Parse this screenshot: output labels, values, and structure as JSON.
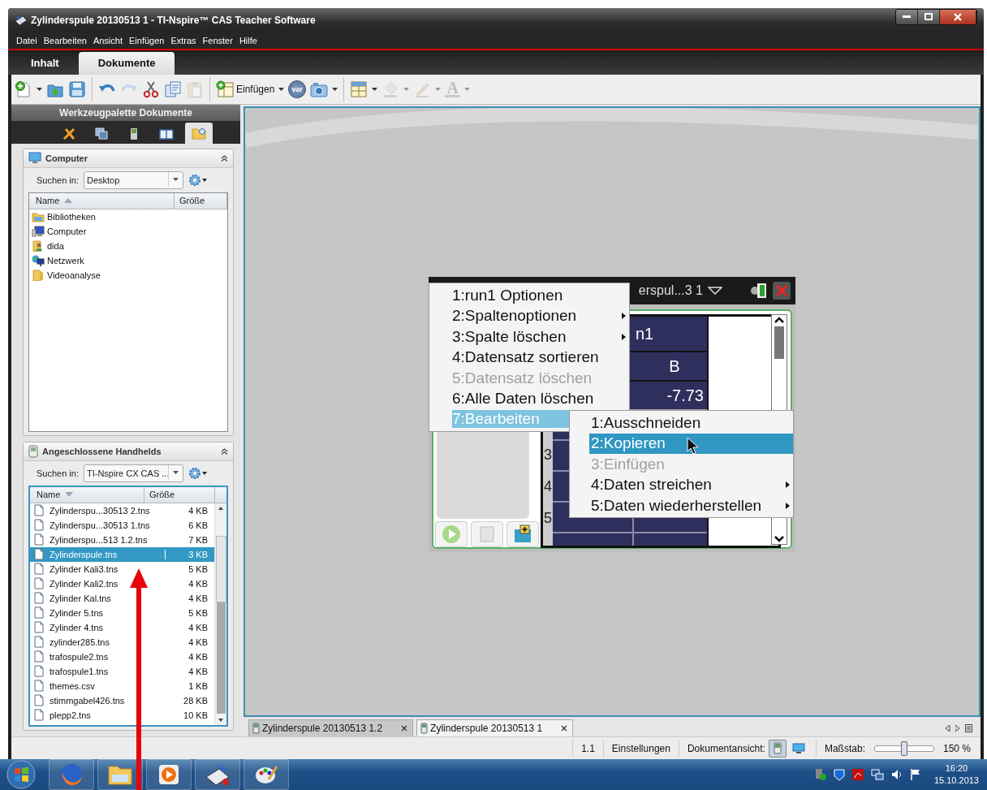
{
  "window": {
    "title": "Zylinderspule 20130513 1 - TI-Nspire™ CAS Teacher Software"
  },
  "menu": [
    "Datei",
    "Bearbeiten",
    "Ansicht",
    "Einfügen",
    "Extras",
    "Fenster",
    "Hilfe"
  ],
  "workspace_tabs": [
    {
      "label": "Inhalt",
      "selected": false
    },
    {
      "label": "Dokumente",
      "selected": true
    }
  ],
  "toolbar": [
    {
      "kind": "new",
      "caret": true,
      "disabled": false
    },
    {
      "kind": "open",
      "caret": false,
      "disabled": false
    },
    {
      "kind": "save",
      "caret": false,
      "disabled": false
    },
    {
      "kind": "separator"
    },
    {
      "kind": "undo",
      "caret": false,
      "disabled": false
    },
    {
      "kind": "redo",
      "caret": false,
      "disabled": true
    },
    {
      "kind": "cut",
      "caret": false,
      "disabled": false
    },
    {
      "kind": "copy",
      "caret": false,
      "disabled": false
    },
    {
      "kind": "paste",
      "caret": false,
      "disabled": true
    },
    {
      "kind": "separator"
    },
    {
      "kind": "insert",
      "label": "Einfügen",
      "caret": true,
      "disabled": false
    },
    {
      "kind": "variable",
      "label": "var",
      "caret": false,
      "disabled": false
    },
    {
      "kind": "camera",
      "caret": true,
      "disabled": false
    },
    {
      "kind": "separator"
    },
    {
      "kind": "layout",
      "caret": true,
      "disabled": false
    },
    {
      "kind": "fill",
      "caret": true,
      "disabled": true
    },
    {
      "kind": "pen",
      "caret": true,
      "disabled": true
    },
    {
      "kind": "text",
      "label": "A",
      "caret": true,
      "disabled": true
    }
  ],
  "palette": {
    "title": "Werkzeugpalette Dokumente",
    "tabs": [
      {
        "kind": "tools",
        "selected": false
      },
      {
        "kind": "pages",
        "selected": false
      },
      {
        "kind": "handheld",
        "selected": false
      },
      {
        "kind": "book",
        "selected": false
      },
      {
        "kind": "folder",
        "selected": true
      }
    ]
  },
  "computer_panel": {
    "title": "Computer",
    "search_label": "Suchen in:",
    "location": "Desktop",
    "columns": [
      {
        "label": "Name",
        "sort_descending": false
      },
      {
        "label": "Größe"
      }
    ],
    "rows": [
      {
        "kind": "library",
        "name": "Bibliotheken",
        "selected": false
      },
      {
        "kind": "computer",
        "name": "Computer",
        "selected": false
      },
      {
        "kind": "user",
        "name": "dida",
        "selected": false
      },
      {
        "kind": "network",
        "name": "Netzwerk",
        "selected": false
      },
      {
        "kind": "folder",
        "name": "Videoanalyse",
        "selected": false
      }
    ]
  },
  "handheld_panel": {
    "title": "Angeschlossene Handhelds",
    "search_label": "Suchen in:",
    "location": "TI-Nspire CX CAS ...",
    "columns": [
      {
        "label": "Name",
        "sort_descending": true
      },
      {
        "label": "Größe"
      }
    ],
    "rows": [
      {
        "kind": "file",
        "name": "Zylinderspu...30513 2.tns",
        "size": "4 KB",
        "selected": false
      },
      {
        "kind": "file",
        "name": "Zylinderspu...30513 1.tns",
        "size": "6 KB",
        "selected": false
      },
      {
        "kind": "file",
        "name": "Zylinderspu...513 1.2.tns",
        "size": "7 KB",
        "selected": false
      },
      {
        "kind": "file",
        "name": "Zylinderspule.tns",
        "size": "3 KB",
        "selected": true
      },
      {
        "kind": "file",
        "name": "Zylinder Kali3.tns",
        "size": "5 KB",
        "selected": false
      },
      {
        "kind": "file",
        "name": "Zylinder Kali2.tns",
        "size": "4 KB",
        "selected": false
      },
      {
        "kind": "file",
        "name": "Zylinder Kal.tns",
        "size": "4 KB",
        "selected": false
      },
      {
        "kind": "file",
        "name": "Zylinder 5.tns",
        "size": "5 KB",
        "selected": false
      },
      {
        "kind": "file",
        "name": "Zylinder 4.tns",
        "size": "4 KB",
        "selected": false
      },
      {
        "kind": "file",
        "name": "zylinder285.tns",
        "size": "4 KB",
        "selected": false
      },
      {
        "kind": "file",
        "name": "trafospule2.tns",
        "size": "4 KB",
        "selected": false
      },
      {
        "kind": "file",
        "name": "trafospule1.tns",
        "size": "4 KB",
        "selected": false
      },
      {
        "kind": "file",
        "name": "themes.csv",
        "size": "1 KB",
        "selected": false
      },
      {
        "kind": "file",
        "name": "stimmgabel426.tns",
        "size": "28 KB",
        "selected": false
      },
      {
        "kind": "file",
        "name": "plepp2.tns",
        "size": "10 KB",
        "selected": false
      }
    ]
  },
  "handheld_screen": {
    "title": "erspul...3 1",
    "table": {
      "column_name": "n1",
      "column_unit": "B",
      "value": "-7.73",
      "row_numbers": [
        "3",
        "4",
        "5"
      ]
    },
    "context_menu": [
      {
        "label": "1:run1 Optionen",
        "submenu": false,
        "disabled": false,
        "selected": false
      },
      {
        "label": "2:Spaltenoptionen",
        "submenu": true,
        "disabled": false,
        "selected": false
      },
      {
        "label": "3:Spalte löschen",
        "submenu": true,
        "disabled": false,
        "selected": false
      },
      {
        "label": "4:Datensatz sortieren",
        "submenu": false,
        "disabled": false,
        "selected": false
      },
      {
        "label": "5:Datensatz löschen",
        "submenu": false,
        "disabled": true,
        "selected": false
      },
      {
        "label": "6:Alle Daten löschen",
        "submenu": false,
        "disabled": false,
        "selected": false
      },
      {
        "label": "7:Bearbeiten",
        "submenu": false,
        "disabled": false,
        "selected": true
      }
    ],
    "submenu": [
      {
        "label": "1:Ausschneiden",
        "submenu": false,
        "disabled": false,
        "selected": false
      },
      {
        "label": "2:Kopieren",
        "submenu": false,
        "disabled": false,
        "selected": true
      },
      {
        "label": "3:Einfügen",
        "submenu": false,
        "disabled": true,
        "selected": false
      },
      {
        "label": "4:Daten streichen",
        "submenu": true,
        "disabled": false,
        "selected": false
      },
      {
        "label": "5:Daten wiederherstellen",
        "submenu": true,
        "disabled": false,
        "selected": false
      }
    ]
  },
  "document_tabs": [
    {
      "label": "Zylinderspule 20130513 1.2",
      "selected": false
    },
    {
      "label": "Zylinderspule 20130513 1",
      "selected": true
    }
  ],
  "status_bar": {
    "page": "1.1",
    "settings": "Einstellungen",
    "view_label": "Dokumentansicht:",
    "view_modes": [
      {
        "kind": "handheld",
        "selected": true
      },
      {
        "kind": "computer",
        "selected": false
      }
    ],
    "zoom_label": "Maßstab:",
    "zoom": {
      "level": 0.5
    },
    "zoom_value": "150 %"
  },
  "taskbar": {
    "apps": [
      {
        "kind": "browser"
      },
      {
        "kind": "explorer"
      },
      {
        "kind": "media"
      },
      {
        "kind": "nspire"
      },
      {
        "kind": "paint"
      }
    ],
    "time": "16:20",
    "date": "15.10.2013"
  }
}
